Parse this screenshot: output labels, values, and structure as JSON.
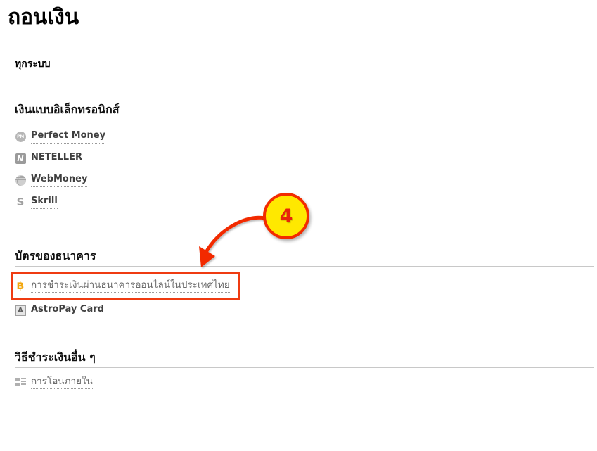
{
  "page": {
    "title": "ถอนเงิน",
    "subtitle": "ทุกระบบ"
  },
  "sections": [
    {
      "id": "e-money",
      "title": "เงินแบบอิเล็กทรอนิกส์",
      "items": [
        {
          "label": "Perfect Money",
          "icon": "perfect-money-icon",
          "icon_text": "PM"
        },
        {
          "label": "NETELLER",
          "icon": "neteller-icon",
          "icon_text": "N"
        },
        {
          "label": "WebMoney",
          "icon": "webmoney-icon",
          "icon_text": ""
        },
        {
          "label": "Skrill",
          "icon": "skrill-icon",
          "icon_text": "S"
        }
      ]
    },
    {
      "id": "bank-cards",
      "title": "บัตรของธนาคาร",
      "items": [
        {
          "label": "การชำระเงินผ่านธนาคารออนไลน์ในประเทศไทย",
          "icon": "thai-baht-icon",
          "icon_text": "฿"
        },
        {
          "label": "AstroPay Card",
          "icon": "astropay-icon",
          "icon_text": "A"
        }
      ]
    },
    {
      "id": "other-methods",
      "title": "วิธีชำระเงินอื่น ๆ",
      "items": [
        {
          "label": "การโอนภายใน",
          "icon": "internal-transfer-icon",
          "icon_text": ""
        }
      ]
    }
  ],
  "annotation": {
    "badge_number": "4",
    "badge_fill": "#ffe800",
    "badge_border": "#f22c00",
    "badge_text_color": "#e8230a",
    "arrow_color": "#f22c00",
    "highlight_border": "#ef3b11",
    "highlight_target": "การชำระเงินผ่านธนาคารออนไลน์ในประเทศไทย"
  }
}
